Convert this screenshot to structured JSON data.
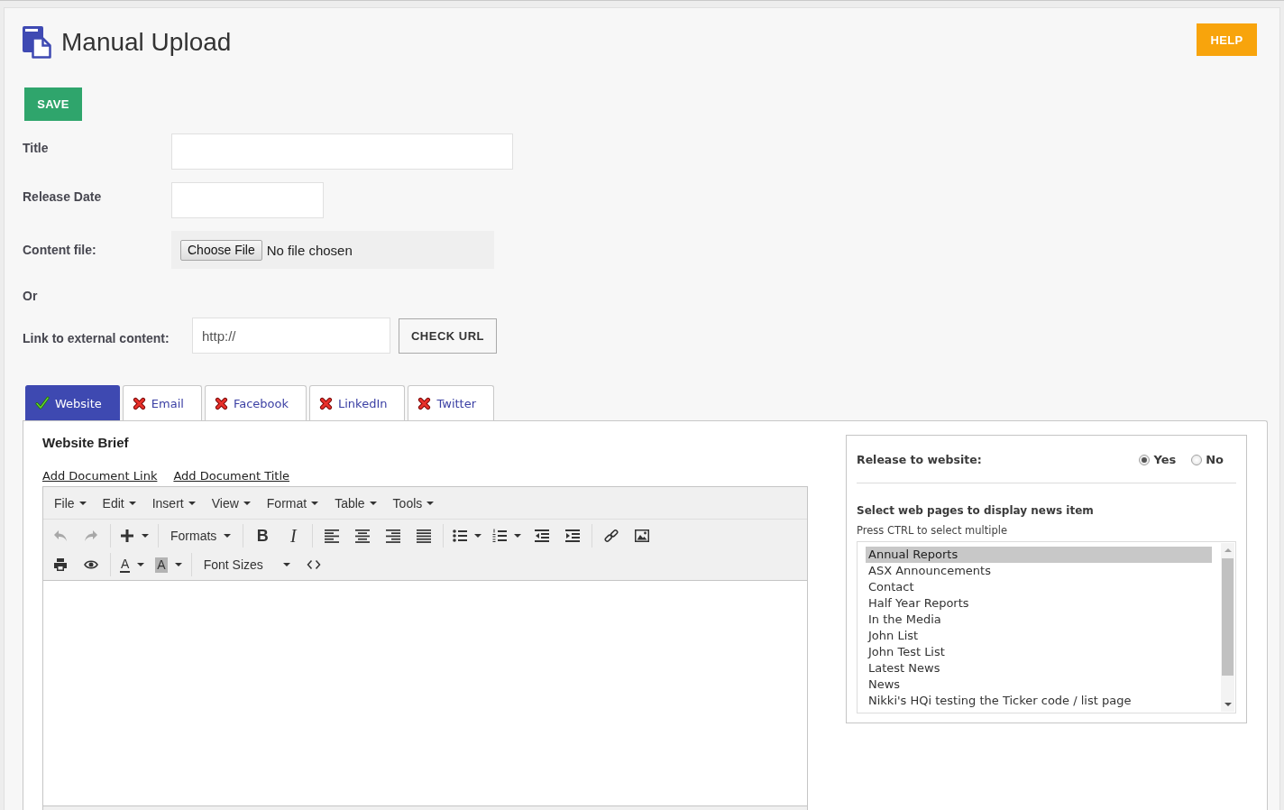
{
  "header": {
    "title": "Manual Upload",
    "help": "HELP"
  },
  "save": "SAVE",
  "form": [
    {
      "kind": "text",
      "label": "Title"
    },
    {
      "kind": "date",
      "label": "Release Date"
    },
    {
      "kind": "file",
      "label": "Content file:",
      "button": "Choose File",
      "status": "No file chosen"
    },
    {
      "kind": "note",
      "label": "Or"
    },
    {
      "kind": "url",
      "label": "Link to external content:",
      "value": "http://",
      "button": "CHECK URL"
    }
  ],
  "tabs": [
    {
      "label": "Website",
      "selected": true,
      "enabled": true
    },
    {
      "label": "Email",
      "selected": false,
      "enabled": false
    },
    {
      "label": "Facebook",
      "selected": false,
      "enabled": false
    },
    {
      "label": "LinkedIn",
      "selected": false,
      "enabled": false
    },
    {
      "label": "Twitter",
      "selected": false,
      "enabled": false
    }
  ],
  "brief": {
    "title": "Website Brief",
    "links": [
      "Add Document Link",
      "Add Document Title"
    ]
  },
  "editor": {
    "menus": [
      "File",
      "Edit",
      "Insert",
      "View",
      "Format",
      "Table",
      "Tools"
    ],
    "toolbar": [
      [
        [
          {
            "kind": "undo",
            "disabled": true
          },
          {
            "kind": "redo",
            "disabled": true
          }
        ],
        [
          {
            "kind": "insert",
            "disabled": false
          }
        ],
        [
          {
            "kind": "formats",
            "label": "Formats",
            "disabled": false
          }
        ],
        [
          {
            "kind": "bold",
            "label": "B",
            "disabled": false
          },
          {
            "kind": "italic",
            "label": "I",
            "disabled": false
          }
        ],
        [
          {
            "kind": "align-left",
            "disabled": false
          },
          {
            "kind": "align-center",
            "disabled": false
          },
          {
            "kind": "align-right",
            "disabled": false
          },
          {
            "kind": "justify",
            "disabled": false
          }
        ],
        [
          {
            "kind": "bullet-list",
            "disabled": false
          },
          {
            "kind": "numbered-list",
            "disabled": false
          },
          {
            "kind": "outdent",
            "disabled": false
          },
          {
            "kind": "indent",
            "disabled": false
          }
        ],
        [
          {
            "kind": "link",
            "disabled": false
          },
          {
            "kind": "image",
            "disabled": false
          }
        ]
      ],
      [
        [
          {
            "kind": "print",
            "disabled": false
          },
          {
            "kind": "preview",
            "disabled": false
          }
        ],
        [
          {
            "kind": "text-color",
            "label": "A",
            "disabled": false
          },
          {
            "kind": "highlight-color",
            "label": "A",
            "disabled": false
          }
        ],
        [
          {
            "kind": "font-sizes",
            "label": "Font Sizes",
            "disabled": false
          },
          {
            "kind": "code",
            "disabled": false
          }
        ]
      ]
    ]
  },
  "release": {
    "label": "Release to website:",
    "options": [
      {
        "label": "Yes",
        "selected": true
      },
      {
        "label": "No",
        "selected": false
      }
    ]
  },
  "pages": {
    "title": "Select web pages to display news item",
    "hint": "Press CTRL to select multiple",
    "items": [
      {
        "label": "Annual Reports",
        "selected": true
      },
      {
        "label": "ASX Announcements",
        "selected": false
      },
      {
        "label": "Contact",
        "selected": false
      },
      {
        "label": "Half Year Reports",
        "selected": false
      },
      {
        "label": "In the Media",
        "selected": false
      },
      {
        "label": "John List",
        "selected": false
      },
      {
        "label": "John Test List",
        "selected": false
      },
      {
        "label": "Latest News",
        "selected": false
      },
      {
        "label": "News",
        "selected": false
      },
      {
        "label": "Nikki's HQi testing the Ticker code / list page",
        "selected": false
      }
    ]
  }
}
